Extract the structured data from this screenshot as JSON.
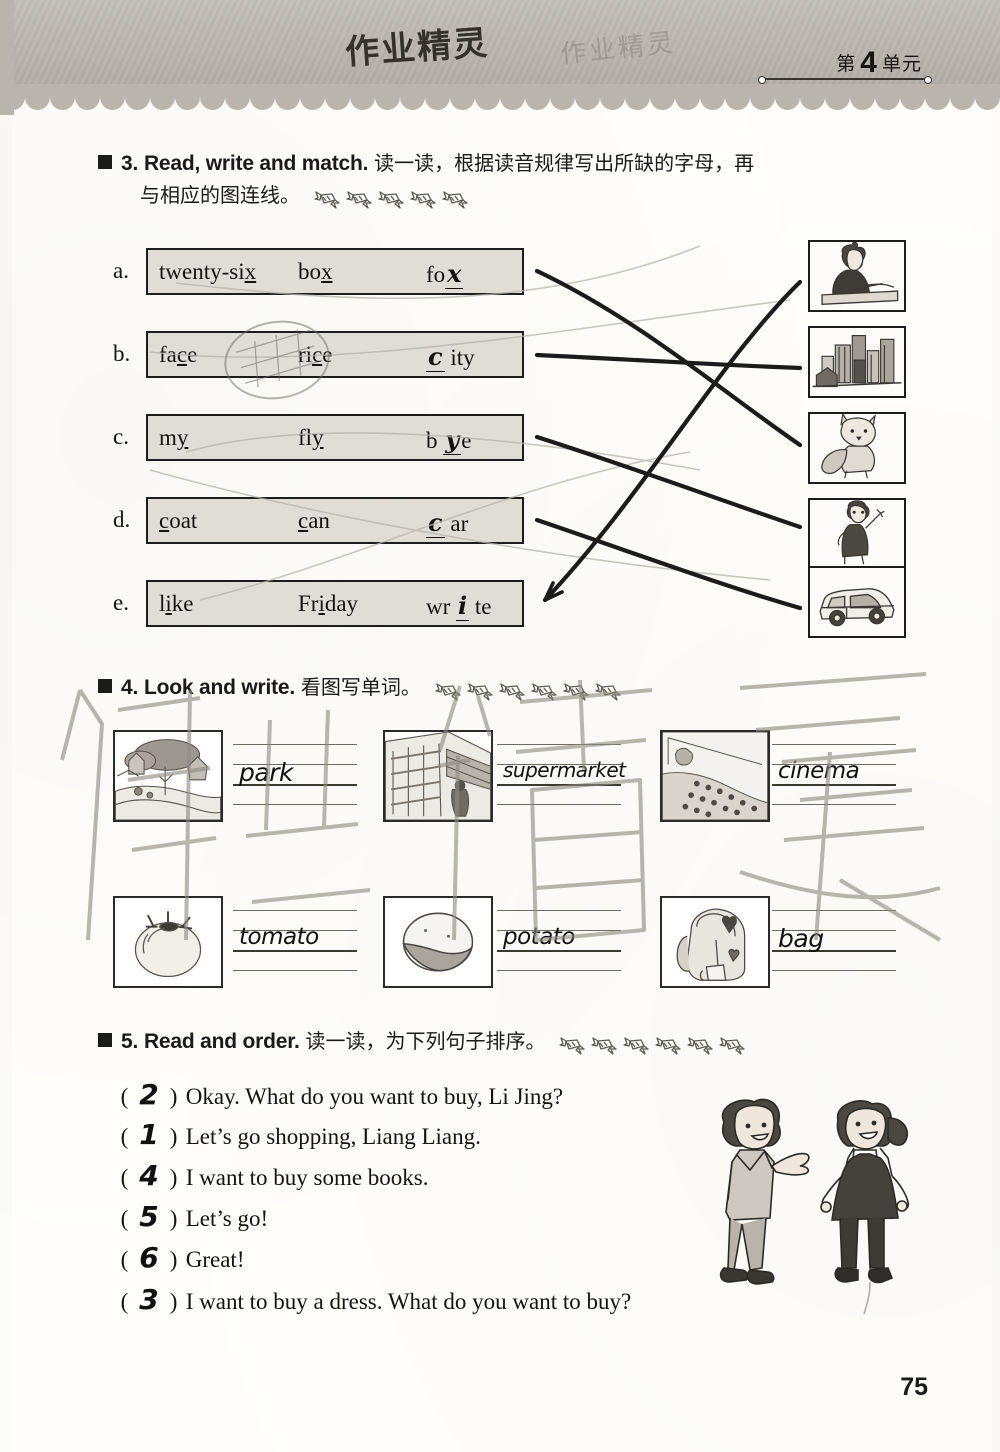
{
  "page": {
    "number": "75",
    "unit_prefix": "第",
    "unit_number": "4",
    "unit_suffix": "单元",
    "watermark_top": "作业精灵",
    "watermark_big": "作业精灵",
    "ghost_header": "作业精灵"
  },
  "exercise3": {
    "number": "3.",
    "title_en": "Read, write and match.",
    "title_cn_line1": "读一读，根据读音规律写出所缺的字母，再",
    "title_cn_line2": "与相应的图连线。",
    "candy_count": 5,
    "rows": [
      {
        "label": "a.",
        "word1_pre": "twenty-si",
        "word1_u": "x",
        "word1_post": "",
        "word2_pre": "bo",
        "word2_u": "x",
        "word2_post": "",
        "word3_pre": "fo",
        "word3_answer": "x",
        "word3_post": "",
        "picture": "fox"
      },
      {
        "label": "b.",
        "word1_pre": "fa",
        "word1_u": "c",
        "word1_post": "e",
        "word2_pre": "ri",
        "word2_u": "c",
        "word2_post": "e",
        "word3_pre": "",
        "word3_answer": "c",
        "word3_post": " ity",
        "picture": "city"
      },
      {
        "label": "c.",
        "word1_pre": "m",
        "word1_u": "y",
        "word1_post": "",
        "word2_pre": "fl",
        "word2_u": "y",
        "word2_post": "",
        "word3_pre": "b ",
        "word3_answer": "y",
        "word3_post": "e",
        "picture": "bye"
      },
      {
        "label": "d.",
        "word1_pre": "",
        "word1_u": "c",
        "word1_post": "oat",
        "word2_pre": "",
        "word2_u": "c",
        "word2_post": "an",
        "word3_pre": "",
        "word3_answer": "c",
        "word3_post": " ar",
        "picture": "car"
      },
      {
        "label": "e.",
        "word1_pre": "l",
        "word1_u": "i",
        "word1_post": "ke",
        "word2_pre": "Fr",
        "word2_u": "i",
        "word2_post": "day",
        "word3_pre": "wr ",
        "word3_answer": "i",
        "word3_post": " te",
        "picture": "write"
      }
    ],
    "pictures": [
      {
        "name": "write",
        "alt": "girl writing at desk"
      },
      {
        "name": "city",
        "alt": "city skyline"
      },
      {
        "name": "fox",
        "alt": "fox"
      },
      {
        "name": "bye",
        "alt": "person waving goodbye"
      },
      {
        "name": "car",
        "alt": "car"
      }
    ],
    "matches": [
      {
        "from": "a",
        "to": "fox"
      },
      {
        "from": "b",
        "to": "city"
      },
      {
        "from": "c",
        "to": "bye"
      },
      {
        "from": "d",
        "to": "car"
      },
      {
        "from": "e",
        "to": "write"
      }
    ]
  },
  "exercise4": {
    "number": "4.",
    "title_en": "Look and write.",
    "title_cn": "看图写单词。",
    "candy_count": 6,
    "items": [
      {
        "picture": "park",
        "answer": "park"
      },
      {
        "picture": "supermarket",
        "answer": "supermarket"
      },
      {
        "picture": "cinema",
        "answer": "cinema"
      },
      {
        "picture": "tomato",
        "answer": "tomato"
      },
      {
        "picture": "potato",
        "answer": "potato"
      },
      {
        "picture": "bag",
        "answer": "bag"
      }
    ]
  },
  "exercise5": {
    "number": "5.",
    "title_en": "Read and order.",
    "title_cn": "读一读，为下列句子排序。",
    "candy_count": 6,
    "sentences": [
      {
        "answer": "2",
        "text": "Okay. What do you want to buy, Li Jing?"
      },
      {
        "answer": "1",
        "text": "Let's go shopping, Liang Liang."
      },
      {
        "answer": "4",
        "text": "I want to buy some books."
      },
      {
        "answer": "5",
        "text": "Let's go!"
      },
      {
        "answer": "6",
        "text": "Great!"
      },
      {
        "answer": "3",
        "text": "I want to buy a dress. What do you want to buy?"
      }
    ],
    "illustration": "boy-and-girl-talking"
  }
}
